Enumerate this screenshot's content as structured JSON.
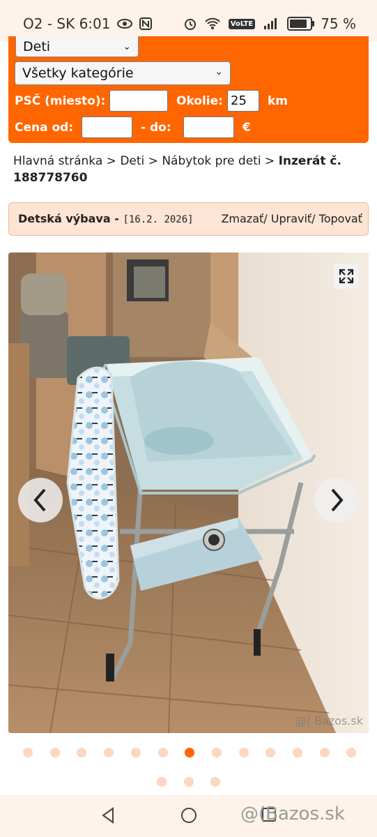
{
  "status_bar": {
    "carrier_time": "O2 - SK 6:01",
    "battery": "75 %",
    "volte": "VoLTE"
  },
  "filter": {
    "section_value": "Deti",
    "category_value": "Všetky kategórie",
    "psc_label": "PSČ (miesto):",
    "psc_value": "",
    "okolie_label": "Okolie:",
    "okolie_value": "25",
    "km_label": "km",
    "cena_od_label": "Cena od:",
    "cena_od_value": "",
    "do_label": "- do:",
    "do_value": "",
    "currency": "€"
  },
  "breadcrumb": {
    "home": "Hlavná stránka",
    "sep": ">",
    "cat1": "Deti",
    "cat2": "Nábytok pre deti",
    "current": "Inzerát č. 188778760"
  },
  "ad_header": {
    "title": "Detská výbava",
    "dash": "-",
    "date": "[16.2. 2026]",
    "actions": "Zmazať/ Upraviť/ Topovať"
  },
  "gallery": {
    "watermark": "@( Bazos.sk",
    "dot_count": 16,
    "active_index": 6
  },
  "nav": {
    "watermark": "@(Bazos.sk"
  },
  "colors": {
    "brand": "#ff6600",
    "header_bg": "#fde4d4"
  }
}
